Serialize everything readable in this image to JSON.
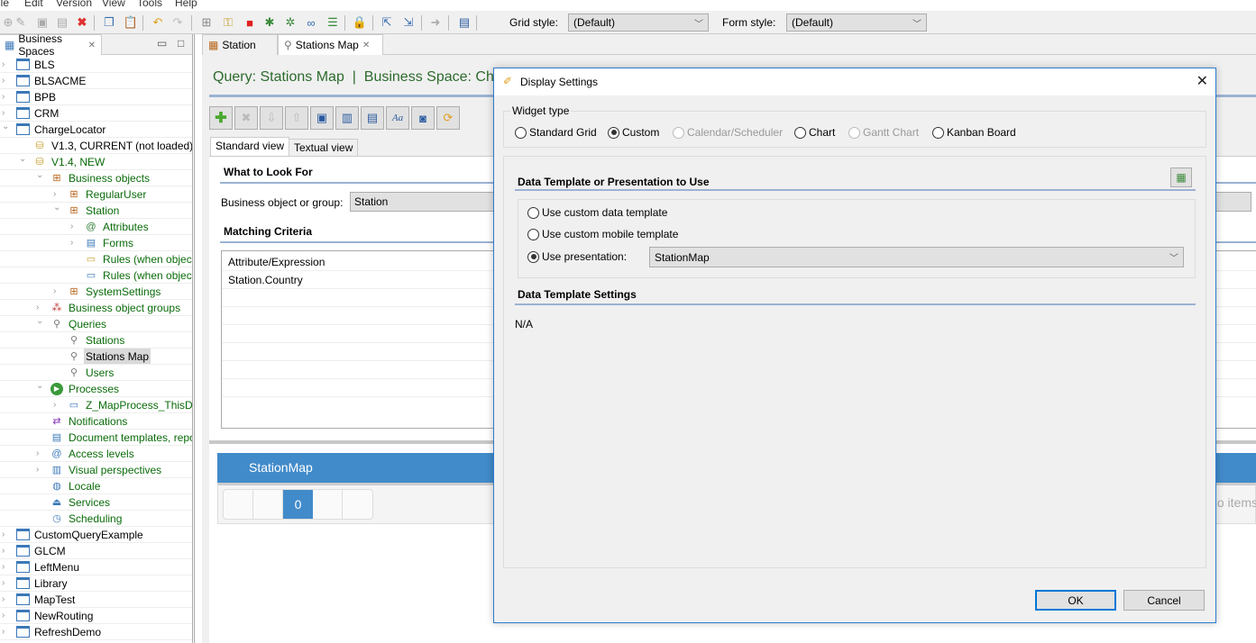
{
  "menu": [
    "ile",
    "Edit",
    "Version",
    "View",
    "Tools",
    "Help"
  ],
  "toolbar": {
    "icons": [
      "new-icon",
      "edit-icon",
      "save-icon",
      "save-all-icon",
      "delete-icon",
      "copy-icon",
      "paste-icon",
      "undo-icon",
      "redo-icon",
      "add-module-icon",
      "key-icon",
      "run-icon",
      "debug-attach-icon",
      "debug-icon",
      "glasses-icon",
      "checklist-icon",
      "lock-icon",
      "export-icon",
      "import-icon",
      "deploy-icon",
      "message-icon"
    ],
    "grid_style_label": "Grid style:",
    "grid_style_value": "(Default)",
    "form_style_label": "Form style:",
    "form_style_value": "(Default)"
  },
  "left_panel": {
    "tab_label": "Business Spaces",
    "tree": [
      {
        "label": "BLS",
        "level": 0,
        "twisty": ">",
        "icon": "project",
        "green": false
      },
      {
        "label": "BLSACME",
        "level": 0,
        "twisty": ">",
        "icon": "project",
        "green": false
      },
      {
        "label": "BPB",
        "level": 0,
        "twisty": ">",
        "icon": "project",
        "green": false
      },
      {
        "label": "CRM",
        "level": 0,
        "twisty": ">",
        "icon": "project",
        "green": false
      },
      {
        "label": "ChargeLocator",
        "level": 0,
        "twisty": "v",
        "icon": "project",
        "green": false
      },
      {
        "label": "V1.3, CURRENT (not loaded)",
        "level": 1,
        "twisty": "",
        "icon": "jar",
        "green": false
      },
      {
        "label": "V1.4, NEW",
        "level": 1,
        "twisty": "v",
        "icon": "jar",
        "green": true
      },
      {
        "label": "Business objects",
        "level": 2,
        "twisty": "v",
        "icon": "objects",
        "green": true
      },
      {
        "label": "RegularUser",
        "level": 3,
        "twisty": ">",
        "icon": "object",
        "green": true
      },
      {
        "label": "Station",
        "level": 3,
        "twisty": "v",
        "icon": "object",
        "green": true
      },
      {
        "label": "Attributes",
        "level": 4,
        "twisty": ">",
        "icon": "at",
        "green": true
      },
      {
        "label": "Forms",
        "level": 4,
        "twisty": ">",
        "icon": "form",
        "green": true
      },
      {
        "label": "Rules (when object",
        "level": 4,
        "twisty": "",
        "icon": "rule",
        "green": true
      },
      {
        "label": "Rules (when object",
        "level": 4,
        "twisty": "",
        "icon": "rule-del",
        "green": true
      },
      {
        "label": "SystemSettings",
        "level": 3,
        "twisty": ">",
        "icon": "object",
        "green": true
      },
      {
        "label": "Business object groups",
        "level": 2,
        "twisty": ">",
        "icon": "groups",
        "green": true
      },
      {
        "label": "Queries",
        "level": 2,
        "twisty": "v",
        "icon": "search",
        "green": true
      },
      {
        "label": "Stations",
        "level": 3,
        "twisty": "",
        "icon": "search",
        "green": true
      },
      {
        "label": "Stations Map",
        "level": 3,
        "twisty": "",
        "icon": "search",
        "green": false,
        "selected": true
      },
      {
        "label": "Users",
        "level": 3,
        "twisty": "",
        "icon": "search",
        "green": true
      },
      {
        "label": "Processes",
        "level": 2,
        "twisty": "v",
        "icon": "process",
        "green": true
      },
      {
        "label": "Z_MapProcess_ThisDo",
        "level": 3,
        "twisty": ">",
        "icon": "process-item",
        "green": true
      },
      {
        "label": "Notifications",
        "level": 2,
        "twisty": "",
        "icon": "notify",
        "green": true
      },
      {
        "label": "Document templates, repo",
        "level": 2,
        "twisty": "",
        "icon": "doc",
        "green": true
      },
      {
        "label": "Access levels",
        "level": 2,
        "twisty": ">",
        "icon": "access",
        "green": true
      },
      {
        "label": "Visual perspectives",
        "level": 2,
        "twisty": ">",
        "icon": "perspective",
        "green": true
      },
      {
        "label": "Locale",
        "level": 2,
        "twisty": "",
        "icon": "globe",
        "green": true
      },
      {
        "label": "Services",
        "level": 2,
        "twisty": "",
        "icon": "service",
        "green": true
      },
      {
        "label": "Scheduling",
        "level": 2,
        "twisty": "",
        "icon": "clock",
        "green": true
      },
      {
        "label": "CustomQueryExample",
        "level": 0,
        "twisty": ">",
        "icon": "project",
        "green": false
      },
      {
        "label": "GLCM",
        "level": 0,
        "twisty": ">",
        "icon": "project",
        "green": false
      },
      {
        "label": "LeftMenu",
        "level": 0,
        "twisty": ">",
        "icon": "project",
        "green": false
      },
      {
        "label": "Library",
        "level": 0,
        "twisty": ">",
        "icon": "project",
        "green": false
      },
      {
        "label": "MapTest",
        "level": 0,
        "twisty": ">",
        "icon": "project",
        "green": false
      },
      {
        "label": "NewRouting",
        "level": 0,
        "twisty": ">",
        "icon": "project",
        "green": false
      },
      {
        "label": "RefreshDemo",
        "level": 0,
        "twisty": ">",
        "icon": "project",
        "green": false
      }
    ]
  },
  "editor": {
    "tabs": [
      {
        "label": "Station",
        "active": false
      },
      {
        "label": "Stations Map",
        "active": true
      }
    ],
    "title": "Query: Stations Map  |  Business Space: Char",
    "subtabs": [
      "Standard view",
      "Textual view"
    ],
    "what_to_look_for": "What to Look For",
    "bo_label": "Business object or group:",
    "bo_value": "Station",
    "matching_criteria": "Matching Criteria",
    "criteria_header": "Attribute/Expression",
    "criteria_rows": [
      "Station.Country"
    ],
    "preview_title": "StationMap",
    "pager_current": "0",
    "items_text": "o items"
  },
  "dialog": {
    "title": "Display Settings",
    "widget_type_label": "Widget type",
    "widget_types": [
      {
        "label": "Standard Grid",
        "checked": false,
        "disabled": false
      },
      {
        "label": "Custom",
        "checked": true,
        "disabled": false
      },
      {
        "label": "Calendar/Scheduler",
        "checked": false,
        "disabled": true
      },
      {
        "label": "Chart",
        "checked": false,
        "disabled": false
      },
      {
        "label": "Gantt Chart",
        "checked": false,
        "disabled": true
      },
      {
        "label": "Kanban Board",
        "checked": false,
        "disabled": false
      }
    ],
    "data_template_heading": "Data Template or Presentation to Use",
    "options": [
      {
        "label": "Use custom data template",
        "checked": false
      },
      {
        "label": "Use custom mobile template",
        "checked": false
      },
      {
        "label": "Use presentation:",
        "checked": true
      }
    ],
    "presentation_value": "StationMap",
    "settings_heading": "Data Template Settings",
    "settings_value": "N/A",
    "ok_label": "OK",
    "cancel_label": "Cancel"
  }
}
